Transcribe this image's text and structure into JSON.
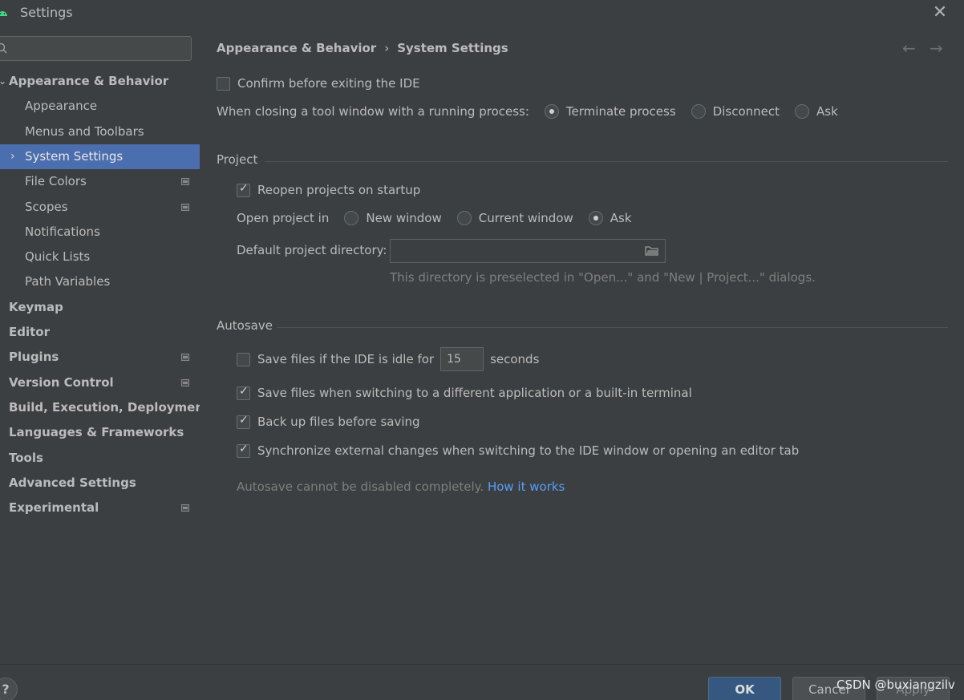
{
  "window": {
    "title": "Settings"
  },
  "search": {
    "placeholder": "",
    "value": ""
  },
  "sidebar": {
    "items": [
      {
        "label": "Appearance & Behavior",
        "level": "top",
        "expanded": true
      },
      {
        "label": "Appearance",
        "level": "sub"
      },
      {
        "label": "Menus and Toolbars",
        "level": "sub"
      },
      {
        "label": "System Settings",
        "level": "sub",
        "selected": true
      },
      {
        "label": "File Colors",
        "level": "sub",
        "badge": true
      },
      {
        "label": "Scopes",
        "level": "sub",
        "badge": true
      },
      {
        "label": "Notifications",
        "level": "sub"
      },
      {
        "label": "Quick Lists",
        "level": "sub"
      },
      {
        "label": "Path Variables",
        "level": "sub"
      },
      {
        "label": "Keymap",
        "level": "top"
      },
      {
        "label": "Editor",
        "level": "top"
      },
      {
        "label": "Plugins",
        "level": "top",
        "badge": true
      },
      {
        "label": "Version Control",
        "level": "top",
        "badge": true
      },
      {
        "label": "Build, Execution, Deployment",
        "level": "top"
      },
      {
        "label": "Languages & Frameworks",
        "level": "top"
      },
      {
        "label": "Tools",
        "level": "top"
      },
      {
        "label": "Advanced Settings",
        "level": "top"
      },
      {
        "label": "Experimental",
        "level": "top",
        "badge": true
      }
    ]
  },
  "breadcrumb": {
    "parent": "Appearance & Behavior",
    "separator": "›",
    "current": "System Settings"
  },
  "nav": {
    "back": "←",
    "forward": "→"
  },
  "general": {
    "confirm_exit": {
      "label": "Confirm before exiting the IDE",
      "checked": false
    },
    "closing_tool_window": {
      "label": "When closing a tool window with a running process:",
      "options": [
        "Terminate process",
        "Disconnect",
        "Ask"
      ],
      "selected": "Terminate process"
    }
  },
  "project": {
    "title": "Project",
    "reopen": {
      "label": "Reopen projects on startup",
      "checked": true
    },
    "open_in": {
      "label": "Open project in",
      "options": [
        "New window",
        "Current window",
        "Ask"
      ],
      "selected": "Ask"
    },
    "default_dir": {
      "label": "Default project directory:",
      "value": "",
      "hint": "This directory is preselected in \"Open...\" and \"New | Project...\" dialogs."
    }
  },
  "autosave": {
    "title": "Autosave",
    "idle": {
      "label": "Save files if the IDE is idle for",
      "value": "15",
      "unit": "seconds",
      "checked": false
    },
    "switching": {
      "label": "Save files when switching to a different application or a built-in terminal",
      "checked": true
    },
    "backup": {
      "label": "Back up files before saving",
      "checked": true
    },
    "sync": {
      "label": "Synchronize external changes when switching to the IDE window or opening an editor tab",
      "checked": true
    },
    "note": "Autosave cannot be disabled completely.",
    "link": "How it works"
  },
  "footer": {
    "help": "?",
    "ok": "OK",
    "cancel": "Cancel",
    "apply": "Apply",
    "watermark": "CSDN @buxiangzilv"
  },
  "colors": {
    "background": "#3c3f41",
    "selection": "#4b6eaf",
    "link": "#589df6",
    "ok_button": "#365880"
  }
}
